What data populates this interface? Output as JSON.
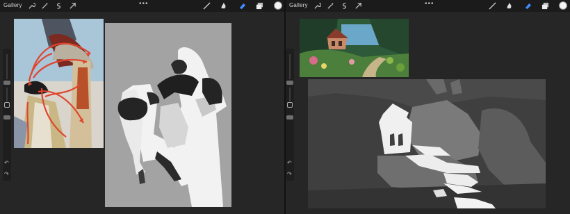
{
  "left_app": {
    "gallery_label": "Gallery",
    "tool_icons": [
      "wrench-icon",
      "magic-wand-icon",
      "selection-icon",
      "move-arrow-icon"
    ],
    "brush_icons": [
      "brush-icon",
      "smudge-icon",
      "eraser-icon",
      "layers-icon"
    ],
    "active_tool": "eraser-icon",
    "current_color": "#f4f4f4"
  },
  "right_app": {
    "gallery_label": "Gallery",
    "tool_icons": [
      "wrench-icon",
      "magic-wand-icon",
      "selection-icon",
      "move-arrow-icon"
    ],
    "brush_icons": [
      "brush-icon",
      "smudge-icon",
      "eraser-icon",
      "layers-icon"
    ],
    "active_tool": "eraser-icon",
    "current_color": "#f4f4f4"
  },
  "colors": {
    "accent_blue": "#3f8cff",
    "reference_arrow_red": "#e0452e"
  }
}
